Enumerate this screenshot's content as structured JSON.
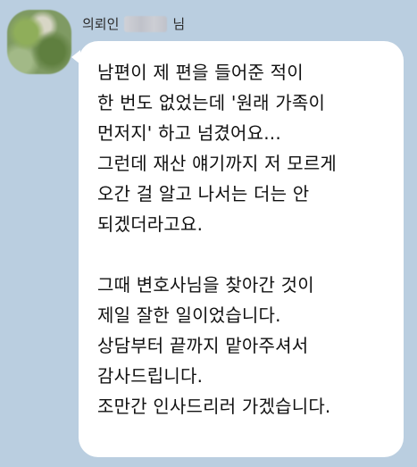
{
  "chat": {
    "sender": {
      "name_prefix": "의뢰인",
      "name_suffix": "님"
    },
    "message": {
      "lines": [
        "남편이 제 편을 들어준 적이",
        "한 번도 없었는데 '원래 가족이",
        "먼저지' 하고 넘겼어요...",
        "그런데 재산 얘기까지 저 모르게",
        "오간 걸 알고 나서는 더는 안",
        "되겠더라고요.",
        "",
        "그때 변호사님을 찾아간 것이",
        "제일 잘한 일이었습니다.",
        "상담부터 끝까지 맡아주셔서",
        "감사드립니다.",
        "조만간 인사드리러 가겠습니다."
      ]
    }
  },
  "theme": {
    "background": "#bacee0",
    "bubble": "#ffffff",
    "text": "#111111"
  }
}
